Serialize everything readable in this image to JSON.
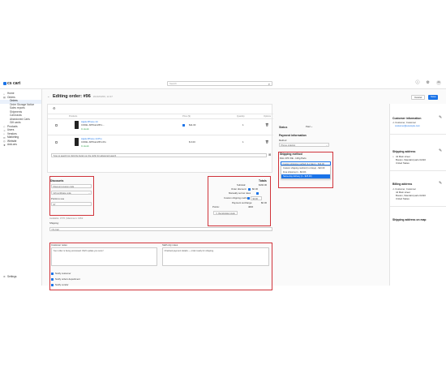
{
  "app": {
    "logo": "cs cart",
    "search_placeholder": "Search",
    "avatar": "AA"
  },
  "sidebar": {
    "items": [
      {
        "label": "Home",
        "icon": "home-icon",
        "level": 0
      },
      {
        "label": "Orders",
        "icon": "orders-icon",
        "level": 0
      },
      {
        "label": "Orders",
        "level": 1,
        "active": true
      },
      {
        "label": "Order Storage Notice",
        "level": 1
      },
      {
        "label": "Sales reports",
        "level": 1
      },
      {
        "label": "Shipments",
        "level": 1
      },
      {
        "label": "Call-backs",
        "level": 1
      },
      {
        "label": "Abandoned Carts",
        "level": 1
      },
      {
        "label": "Gift cards",
        "level": 1
      },
      {
        "label": "Products",
        "icon": "products-icon",
        "level": 0
      },
      {
        "label": "Users",
        "icon": "users-icon",
        "level": 0
      },
      {
        "label": "Vendors",
        "icon": "vendors-icon",
        "level": 0
      },
      {
        "label": "Marketing",
        "icon": "marketing-icon",
        "level": 0
      },
      {
        "label": "Website",
        "icon": "website-icon",
        "level": 0
      },
      {
        "label": "Add-ons",
        "icon": "addons-icon",
        "level": 0
      }
    ],
    "settings": "Settings"
  },
  "page": {
    "title": "Editing order: #96",
    "date": "2023/03/09, 12:47",
    "cancel": "Cancel",
    "save": "Save"
  },
  "products": {
    "headers": [
      "Products",
      "Price ($)",
      "Quantity",
      "Options"
    ],
    "rows": [
      {
        "name": "Apple iPhone 14",
        "code": "CODE: APPLE-MPU-...",
        "stock": "In stock",
        "price": "$11.00",
        "qty": "1"
      },
      {
        "name": "Apple iPhone 14 Pro",
        "code": "CODE: APPLE-MPU-Pro",
        "stock": "In stock",
        "price": "$ 0.00",
        "qty": "1"
      }
    ],
    "search_placeholder": "Type to search (or click the button on the right) for advanced search"
  },
  "discounts": {
    "title": "Discounts",
    "code_placeholder": "Discount coupon code",
    "gift_placeholder": "Gift certificate code",
    "points_label": "Points to use",
    "points_value": "97",
    "available": "Available: 3776 | Maximum: 1952"
  },
  "totals": {
    "title": "Totals",
    "subtotal_label": "Subtotal:",
    "subtotal_value": "$160.00",
    "discount_label": "Order discount:",
    "discount_value": "$0.00",
    "manual_label": "Manually set tax rates",
    "shipping_label": "Custom shipping method:",
    "shipping_value": "$0.00",
    "surcharge_label": "Payment surcharge:",
    "surcharge_value": "$0.00",
    "points_label": "Points:",
    "points_value": "4820",
    "recalc": "Recalculate totals"
  },
  "notes": {
    "customer_label": "Customer notes",
    "customer_text": "Your order is being processed. We'll update you soon!",
    "staff_label": "Staff only notes",
    "staff_text": "Checked payment details — order ready for shipping.",
    "notify_customer": "Notify customer",
    "notify_department": "Notify orders department",
    "notify_vendor": "Notify vendor"
  },
  "status": {
    "label": "Status",
    "value": "Paid",
    "payment_heading": "Payment information",
    "method_label": "Method",
    "method_value": "Phone ordering"
  },
  "shipping": {
    "heading": "Shipping method",
    "subheading": "DHL CPK DE - 100g Parts",
    "selected": "Custom shipping method (1-2 days) - $10.00",
    "options": [
      "Custom shipping method (1-2 days) - $10.00",
      "Free shipping (1 - $0.00)",
      "Same-day delivery (1 - $25.00)"
    ],
    "highlighted_index": 2
  },
  "customer": {
    "heading": "Customer information",
    "name": "Customer, Customer",
    "email": "customer@example.com",
    "shipping_heading": "Shipping address",
    "shipping_lines": [
      "44 Main street",
      "Boston, Standard parts 02116",
      "United States"
    ],
    "billing_heading": "Billing address",
    "billing_name": "Customer, Customer",
    "billing_lines": [
      "44 Main street",
      "Boston, Standard parts 02116",
      "United States"
    ],
    "map_heading": "Shipping address on map"
  }
}
